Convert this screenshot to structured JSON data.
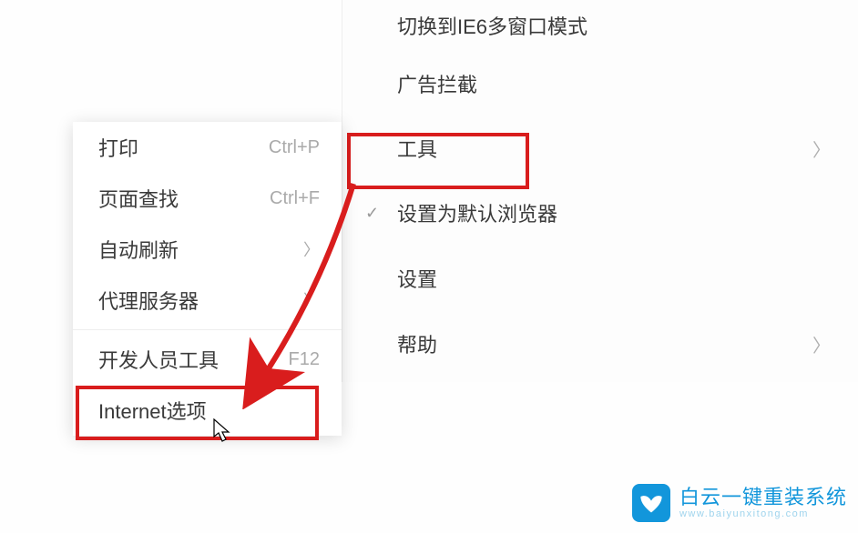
{
  "main_menu": {
    "switch_mode": "切换到IE6多窗口模式",
    "ad_block": "广告拦截",
    "tools": "工具",
    "set_default": "设置为默认浏览器",
    "settings": "设置",
    "help": "帮助"
  },
  "submenu": {
    "print": {
      "label": "打印",
      "shortcut": "Ctrl+P"
    },
    "find": {
      "label": "页面查找",
      "shortcut": "Ctrl+F"
    },
    "auto_refresh": "自动刷新",
    "proxy": "代理服务器",
    "dev_tools": {
      "label": "开发人员工具",
      "shortcut": "F12"
    },
    "internet_options": "Internet选项"
  },
  "watermark": {
    "title": "白云一键重装系统",
    "url": "www.baiyunxitong.com"
  },
  "colors": {
    "highlight": "#d91d1d",
    "brand": "#1296db"
  }
}
